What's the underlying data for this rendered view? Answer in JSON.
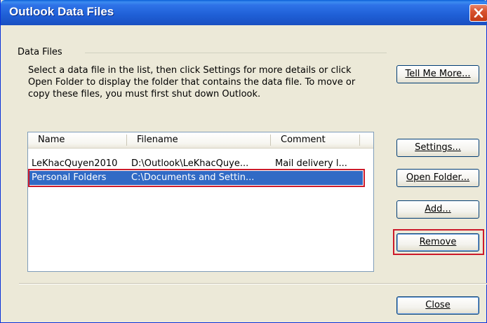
{
  "window": {
    "title": "Outlook Data Files"
  },
  "group": {
    "label": "Data Files",
    "description": "Select a data file in the list, then click Settings for more details or click Open Folder to display the folder that contains the data file. To move or copy these files, you must first shut down Outlook."
  },
  "buttons": {
    "tell_me_more": "Tell Me More...",
    "settings": "Settings...",
    "open_folder": "Open Folder...",
    "add": "Add...",
    "remove": "Remove",
    "close": "Close"
  },
  "list": {
    "columns": [
      "Name",
      "Filename",
      "Comment"
    ],
    "rows": [
      {
        "name": "LeKhacQuyen2010",
        "filename": "D:\\Outlook\\LeKhacQuye...",
        "comment": "Mail delivery l..."
      },
      {
        "name": "Personal Folders",
        "filename": "C:\\Documents and Settin...",
        "comment": ""
      }
    ],
    "selected_row": 1
  },
  "colors": {
    "selection": "#316ac5",
    "highlight_box": "#cc1a2a",
    "titlebar": "#1f5fd6"
  }
}
